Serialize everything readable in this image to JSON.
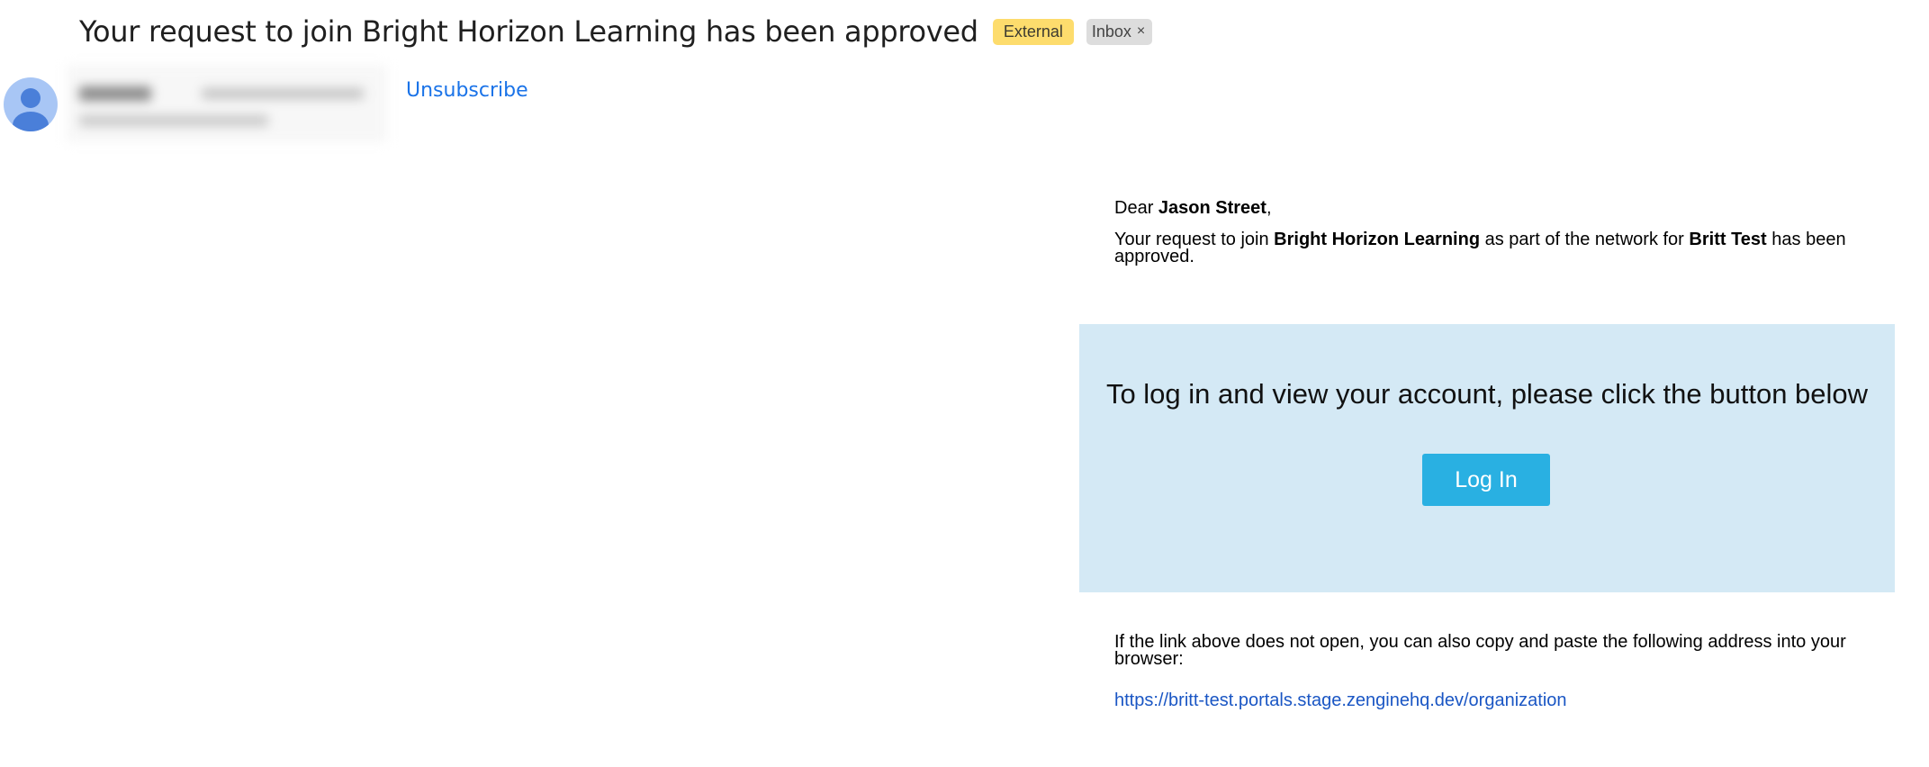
{
  "email": {
    "subject": "Your request to join Bright Horizon Learning has been approved",
    "labels": {
      "external": "External",
      "inbox": "Inbox",
      "inbox_remove": "×"
    },
    "unsubscribe": "Unsubscribe",
    "body": {
      "greeting_prefix": "Dear ",
      "recipient_name": "Jason Street",
      "greeting_suffix": ",",
      "approval_part1": "Your request to join ",
      "organization": "Bright Horizon Learning",
      "approval_part2": " as part of the network for ",
      "network": "Britt Test",
      "approval_part3": " has been approved.",
      "login_prompt": "To log in and view your account, please click the button below",
      "login_button": "Log In",
      "fallback_text": "If the link above does not open, you can also copy and paste the following address into your browser:",
      "fallback_link": "https://britt-test.portals.stage.zenginehq.dev/organization"
    }
  },
  "colors": {
    "external_badge": "#fddc6d",
    "inbox_badge": "#dddddd",
    "link": "#1a73e8",
    "login_box": "#d4e9f5",
    "login_button": "#29b0e2"
  },
  "icons": {
    "avatar": "person-avatar-icon",
    "inbox_remove": "close-icon"
  }
}
